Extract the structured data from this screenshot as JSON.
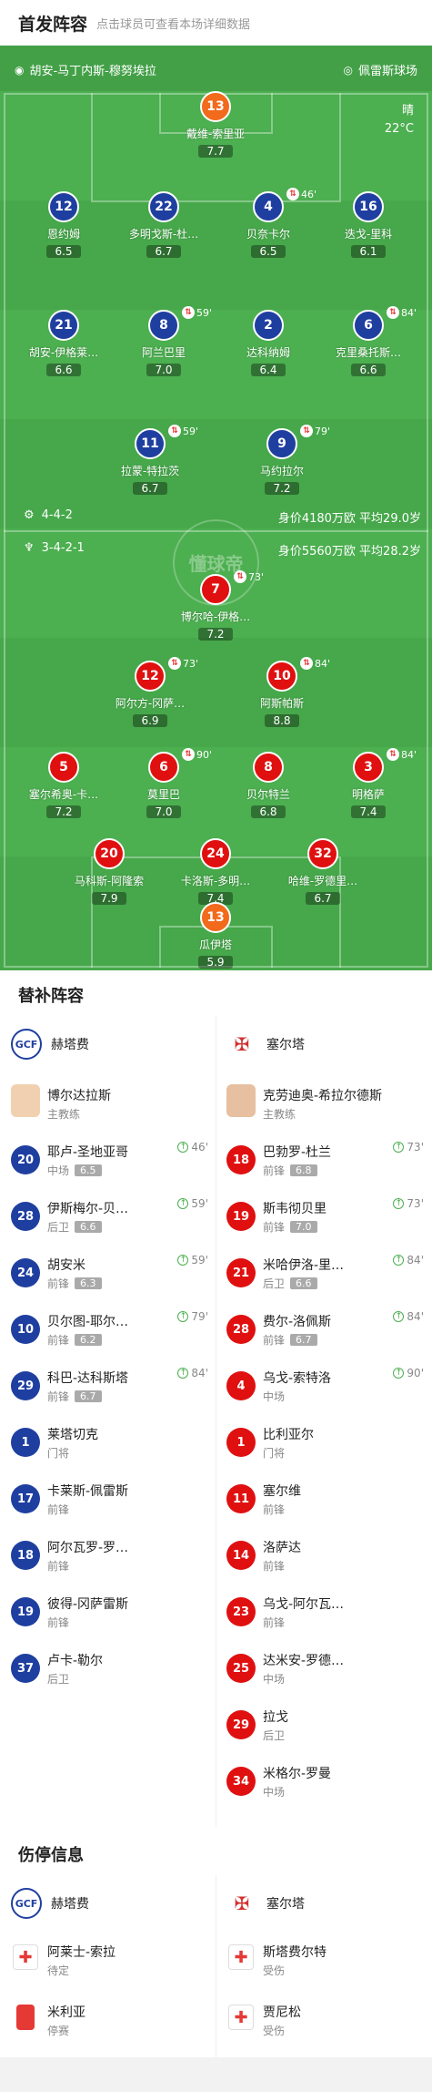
{
  "header": {
    "title": "首发阵容",
    "hint": "点击球员可查看本场详细数据"
  },
  "teams": {
    "home": "胡安-马丁内斯-穆努埃拉",
    "away": "佩雷斯球场"
  },
  "weather": {
    "cond": "晴",
    "temp": "22°C"
  },
  "home_form": {
    "formation": "4-4-2",
    "info": "身价4180万欧 平均29.0岁"
  },
  "away_form": {
    "formation": "3-4-2-1",
    "info": "身价5560万欧 平均28.2岁"
  },
  "watermark": "懂球帝",
  "players": [
    {
      "num": "13",
      "name": "戴维-索里亚",
      "rating": "7.7",
      "color": "orng"
    },
    {
      "num": "12",
      "name": "恩约姆",
      "rating": "6.5",
      "color": "blue"
    },
    {
      "num": "22",
      "name": "多明戈斯-杜…",
      "rating": "6.7",
      "color": "blue"
    },
    {
      "num": "4",
      "name": "贝奈卡尔",
      "rating": "6.5",
      "color": "blue",
      "sub": "46'"
    },
    {
      "num": "16",
      "name": "迭戈-里科",
      "rating": "6.1",
      "color": "blue"
    },
    {
      "num": "21",
      "name": "胡安-伊格莱…",
      "rating": "6.6",
      "color": "blue"
    },
    {
      "num": "8",
      "name": "阿兰巴里",
      "rating": "7.0",
      "color": "blue",
      "sub": "59'"
    },
    {
      "num": "2",
      "name": "达科纳姆",
      "rating": "6.4",
      "color": "blue"
    },
    {
      "num": "6",
      "name": "克里桑托斯…",
      "rating": "6.6",
      "color": "blue",
      "sub": "84'"
    },
    {
      "num": "11",
      "name": "拉蒙-特拉茨",
      "rating": "6.7",
      "color": "blue",
      "sub": "59'"
    },
    {
      "num": "9",
      "name": "马约拉尔",
      "rating": "7.2",
      "color": "blue",
      "sub": "79'"
    },
    {
      "num": "7",
      "name": "博尔哈-伊格…",
      "rating": "7.2",
      "color": "red",
      "sub": "73'"
    },
    {
      "num": "12",
      "name": "阿尔方-冈萨…",
      "rating": "6.9",
      "color": "red",
      "sub": "73'"
    },
    {
      "num": "10",
      "name": "阿斯帕斯",
      "rating": "8.8",
      "color": "red",
      "sub": "84'"
    },
    {
      "num": "5",
      "name": "塞尔希奥-卡…",
      "rating": "7.2",
      "color": "red"
    },
    {
      "num": "6",
      "name": "莫里巴",
      "rating": "7.0",
      "color": "red",
      "sub": "90'"
    },
    {
      "num": "8",
      "name": "贝尔特兰",
      "rating": "6.8",
      "color": "red"
    },
    {
      "num": "3",
      "name": "明格萨",
      "rating": "7.4",
      "color": "red",
      "sub": "84'"
    },
    {
      "num": "20",
      "name": "马科斯-阿隆索",
      "rating": "7.9",
      "color": "red"
    },
    {
      "num": "24",
      "name": "卡洛斯-多明…",
      "rating": "7.4",
      "color": "red"
    },
    {
      "num": "32",
      "name": "哈维-罗德里…",
      "rating": "6.7",
      "color": "red"
    },
    {
      "num": "13",
      "name": "瓜伊塔",
      "rating": "5.9",
      "color": "orng"
    }
  ],
  "subs": {
    "title": "替补阵容",
    "home_team": "赫塔费",
    "away_team": "塞尔塔",
    "home_coach": {
      "name": "博尔达拉斯",
      "role": "主教练"
    },
    "away_coach": {
      "name": "克劳迪奥-希拉尔德斯",
      "role": "主教练"
    },
    "home": [
      {
        "num": "20",
        "name": "耶卢-圣地亚哥",
        "pos": "中场",
        "rating": "6.5",
        "ev": "46'"
      },
      {
        "num": "28",
        "name": "伊斯梅尔-贝…",
        "pos": "后卫",
        "rating": "6.6",
        "ev": "59'"
      },
      {
        "num": "24",
        "name": "胡安米",
        "pos": "前锋",
        "rating": "6.3",
        "ev": "59'"
      },
      {
        "num": "10",
        "name": "贝尔图-耶尔…",
        "pos": "前锋",
        "rating": "6.2",
        "ev": "79'"
      },
      {
        "num": "29",
        "name": "科巴-达科斯塔",
        "pos": "前锋",
        "rating": "6.7",
        "ev": "84'"
      },
      {
        "num": "1",
        "name": "莱塔切克",
        "pos": "门将"
      },
      {
        "num": "17",
        "name": "卡莱斯-佩雷斯",
        "pos": "前锋"
      },
      {
        "num": "18",
        "name": "阿尔瓦罗-罗…",
        "pos": "前锋"
      },
      {
        "num": "19",
        "name": "彼得-冈萨雷斯",
        "pos": "前锋"
      },
      {
        "num": "37",
        "name": "卢卡-勒尔",
        "pos": "后卫"
      }
    ],
    "away": [
      {
        "num": "18",
        "name": "巴勃罗-杜兰",
        "pos": "前锋",
        "rating": "6.8",
        "ev": "73'"
      },
      {
        "num": "19",
        "name": "斯韦彻贝里",
        "pos": "前锋",
        "rating": "7.0",
        "ev": "73'"
      },
      {
        "num": "21",
        "name": "米哈伊洛-里…",
        "pos": "后卫",
        "rating": "6.6",
        "ev": "84'"
      },
      {
        "num": "28",
        "name": "费尔-洛佩斯",
        "pos": "前锋",
        "rating": "6.7",
        "ev": "84'"
      },
      {
        "num": "4",
        "name": "乌戈-索特洛",
        "pos": "中场",
        "ev": "90'"
      },
      {
        "num": "1",
        "name": "比利亚尔",
        "pos": "门将"
      },
      {
        "num": "11",
        "name": "塞尔维",
        "pos": "前锋"
      },
      {
        "num": "14",
        "name": "洛萨达",
        "pos": "前锋"
      },
      {
        "num": "23",
        "name": "乌戈-阿尔瓦…",
        "pos": "前锋"
      },
      {
        "num": "25",
        "name": "达米安-罗德…",
        "pos": "中场"
      },
      {
        "num": "29",
        "name": "拉戈",
        "pos": "后卫"
      },
      {
        "num": "34",
        "name": "米格尔-罗曼",
        "pos": "中场"
      }
    ]
  },
  "injuries": {
    "title": "伤停信息",
    "home_team": "赫塔费",
    "away_team": "塞尔塔",
    "home": [
      {
        "name": "阿莱士-索拉",
        "status": "待定",
        "icon": "medkit-icon"
      },
      {
        "name": "米利亚",
        "status": "停赛",
        "icon": "red-card-icon"
      }
    ],
    "away": [
      {
        "name": "斯塔费尔特",
        "status": "受伤",
        "icon": "medkit-icon"
      },
      {
        "name": "贾尼松",
        "status": "受伤",
        "icon": "medkit-icon"
      }
    ]
  }
}
